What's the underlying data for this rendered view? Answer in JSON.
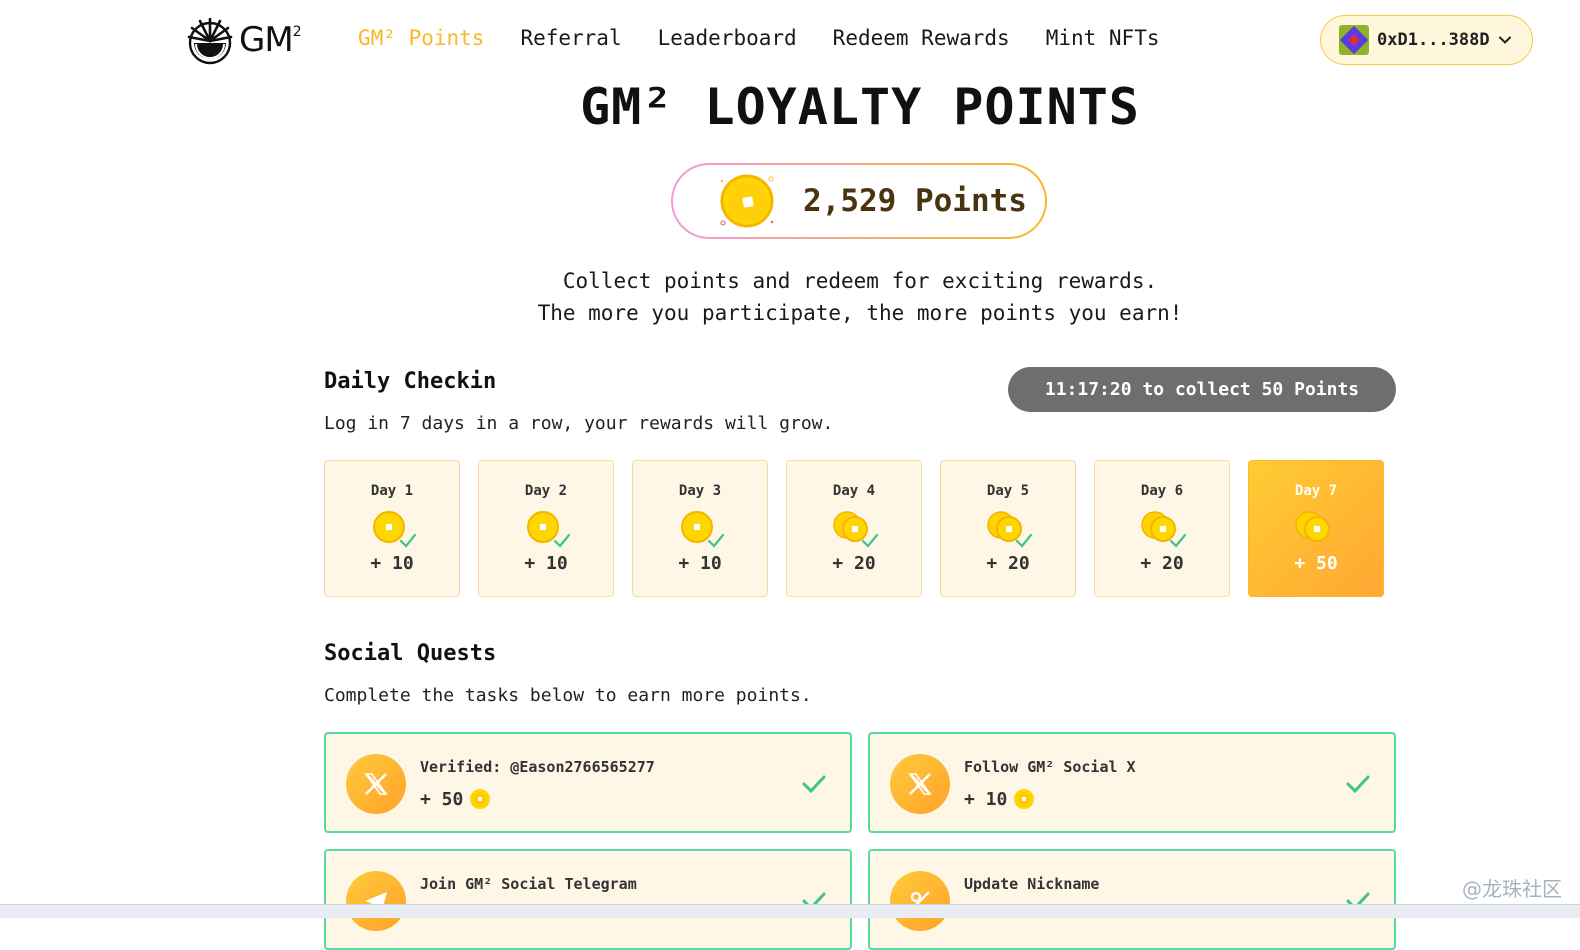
{
  "brand": {
    "name": "GM",
    "superscript": "2"
  },
  "nav": [
    {
      "label": "GM² Points",
      "active": true
    },
    {
      "label": "Referral",
      "active": false
    },
    {
      "label": "Leaderboard",
      "active": false
    },
    {
      "label": "Redeem Rewards",
      "active": false
    },
    {
      "label": "Mint NFTs",
      "active": false
    }
  ],
  "wallet": {
    "address": "0xD1...388D"
  },
  "hero": {
    "title": "GM² LOYALTY POINTS",
    "points": "2,529 Points",
    "subtitle_line1": "Collect points and redeem for exciting rewards.",
    "subtitle_line2": "The more you participate, the more points you earn!"
  },
  "daily": {
    "title": "Daily Checkin",
    "description": "Log in 7 days in a row, your rewards will grow.",
    "countdown": "11:17:20 to collect 50 Points",
    "days": [
      {
        "label": "Day 1",
        "reward": "+ 10",
        "claimed": true
      },
      {
        "label": "Day 2",
        "reward": "+ 10",
        "claimed": true
      },
      {
        "label": "Day 3",
        "reward": "+ 10",
        "claimed": true
      },
      {
        "label": "Day 4",
        "reward": "+ 20",
        "claimed": true
      },
      {
        "label": "Day 5",
        "reward": "+ 20",
        "claimed": true
      },
      {
        "label": "Day 6",
        "reward": "+ 20",
        "claimed": true
      },
      {
        "label": "Day 7",
        "reward": "+ 50",
        "claimed": false
      }
    ]
  },
  "social": {
    "title": "Social Quests",
    "description": "Complete the tasks below to earn more points.",
    "quests": [
      {
        "title": "Verified: @Eason2766565277",
        "reward": "+ 50",
        "icon": "x-logo-icon",
        "done": true
      },
      {
        "title": "Follow GM² Social X",
        "reward": "+ 10",
        "icon": "x-logo-icon",
        "done": true
      },
      {
        "title": "Join GM² Social Telegram",
        "reward": "",
        "icon": "telegram-icon",
        "done": true
      },
      {
        "title": "Update Nickname",
        "reward": "",
        "icon": "edit-icon",
        "done": true
      }
    ]
  },
  "watermark": "@龙珠社区",
  "colors": {
    "accent": "#F7B928",
    "quest_border": "#59D9A3",
    "card_bg": "#FFF7E6",
    "countdown_bg": "#6e6e6e"
  }
}
